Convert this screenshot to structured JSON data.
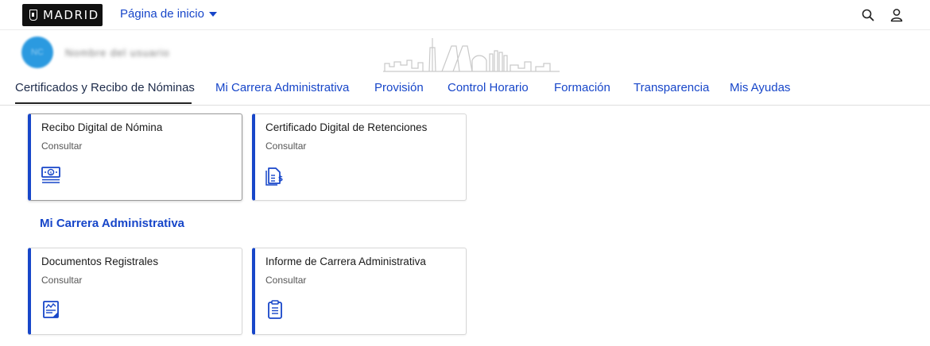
{
  "header": {
    "logo_text": "MADRID",
    "home_menu_label": "Página de inicio",
    "icons": [
      "search-icon",
      "user-icon"
    ]
  },
  "profile": {
    "avatar_initials": "NC",
    "name_blurred": "Nombre del usuario"
  },
  "tabs": [
    {
      "label": "Certificados y Recibo de Nóminas",
      "active": true
    },
    {
      "label": "Mi Carrera Administrativa",
      "active": false
    },
    {
      "label": "Provisión",
      "active": false
    },
    {
      "label": "Control Horario",
      "active": false
    },
    {
      "label": "Formación",
      "active": false
    },
    {
      "label": "Transparencia",
      "active": false
    },
    {
      "label": "Mis Ayudas",
      "active": false
    }
  ],
  "sections": [
    {
      "title": "",
      "cards": [
        {
          "title": "Recibo Digital de Nómina",
          "subtitle": "Consultar",
          "icon": "money-bill-icon"
        },
        {
          "title": "Certificado Digital de Retenciones",
          "subtitle": "Consultar",
          "icon": "certificate-dollar-icon"
        }
      ]
    },
    {
      "title": "Mi Carrera Administrativa",
      "cards": [
        {
          "title": "Documentos Registrales",
          "subtitle": "Consultar",
          "icon": "chart-document-icon"
        },
        {
          "title": "Informe de Carrera Administrativa",
          "subtitle": "Consultar",
          "icon": "clipboard-icon"
        }
      ]
    }
  ],
  "colors": {
    "accent": "#1746c9",
    "header_logo_bg": "#111111"
  }
}
